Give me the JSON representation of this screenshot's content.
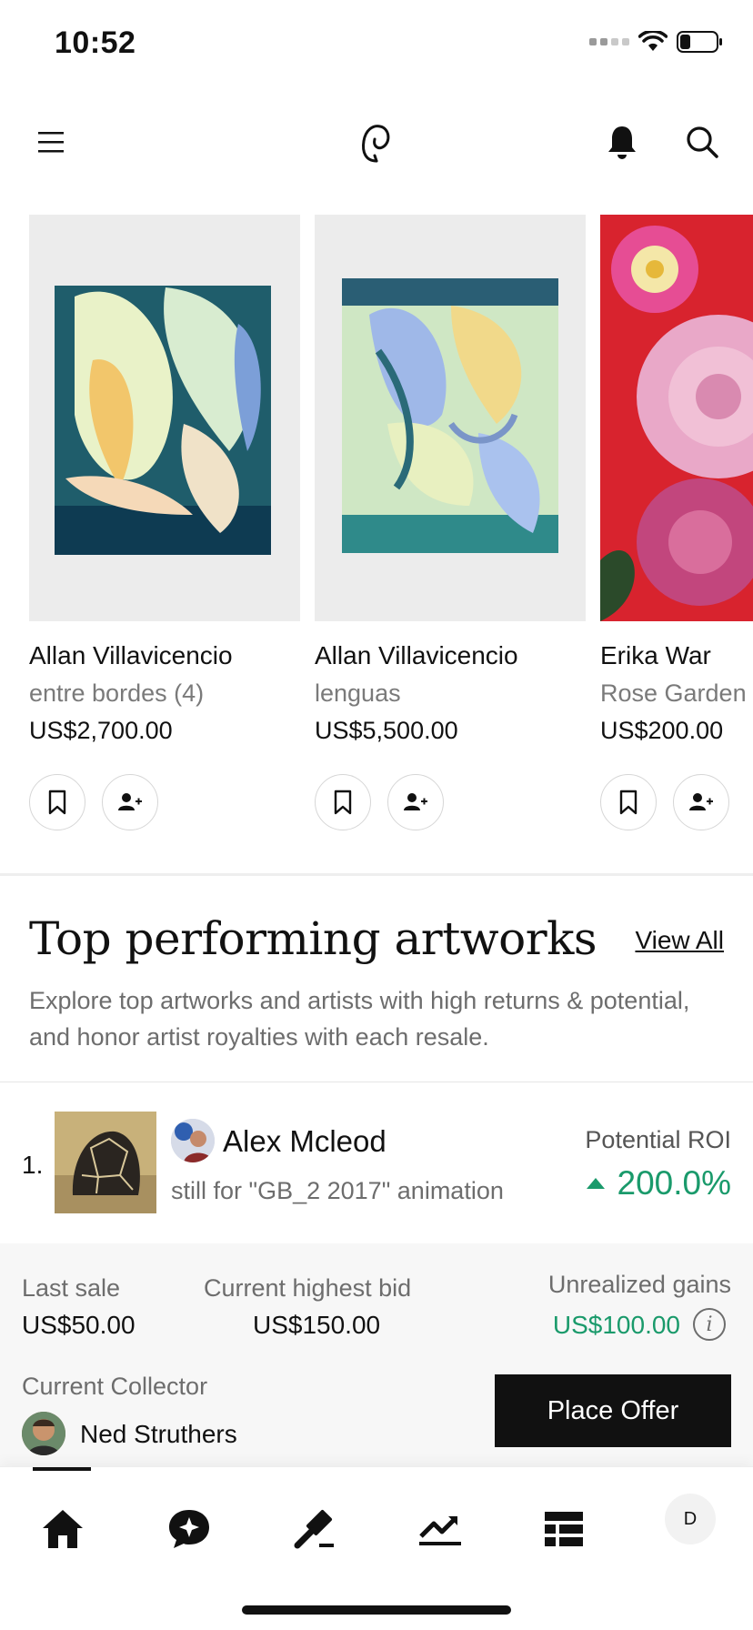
{
  "status_bar": {
    "time": "10:52"
  },
  "header": {
    "menu_icon": "hamburger-menu-icon",
    "logo_icon": "app-logo-icon",
    "notification_icon": "bell-icon",
    "search_icon": "search-icon"
  },
  "carousel": {
    "items": [
      {
        "artist": "Allan Villavicencio",
        "title": "entre bordes (4)",
        "price": "US$2,700.00"
      },
      {
        "artist": "Allan Villavicencio",
        "title": "lenguas",
        "price": "US$5,500.00"
      },
      {
        "artist": "Erika War",
        "title": "Rose Garden",
        "price": "US$200.00"
      }
    ]
  },
  "section": {
    "title": "Top performing artworks",
    "view_all": "View All",
    "description": "Explore top artworks and artists with high returns & potential, and honor artist royalties with each resale."
  },
  "top_item": {
    "rank": "1.",
    "artist": "Alex Mcleod",
    "artwork": "still for \"GB_2 2017\" animation",
    "roi_label": "Potential ROI",
    "roi_value": "200.0%",
    "last_sale_label": "Last sale",
    "last_sale_value": "US$50.00",
    "highest_bid_label": "Current highest bid",
    "highest_bid_value": "US$150.00",
    "gains_label": "Unrealized gains",
    "gains_value": "US$100.00",
    "collector_label": "Current Collector",
    "collector_name": "Ned Struthers",
    "offer_button": "Place Offer"
  },
  "tabbar": {
    "tabs": [
      "home-icon",
      "chat-spark-icon",
      "auction-gavel-icon",
      "trending-chart-icon",
      "list-icon"
    ],
    "profile_initial": "D"
  },
  "colors": {
    "accent_green": "#1a9a6b",
    "dark": "#111111",
    "panel_bg": "#f7f7f7"
  }
}
